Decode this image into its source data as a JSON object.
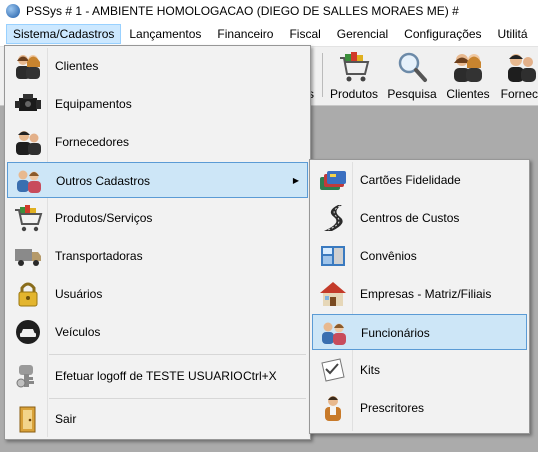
{
  "window": {
    "title": "PSSys # 1 - AMBIENTE HOMOLOGACAO (DIEGO DE SALLES MORAES ME) #"
  },
  "menubar": {
    "items": [
      "Sistema/Cadastros",
      "Lançamentos",
      "Financeiro",
      "Fiscal",
      "Gerencial",
      "Configurações",
      "Utilitá"
    ]
  },
  "toolbar": {
    "partial_label": "s",
    "buttons": [
      {
        "label": "Produtos",
        "icon": "shopping-cart-icon"
      },
      {
        "label": "Pesquisa",
        "icon": "magnifier-icon"
      },
      {
        "label": "Clientes",
        "icon": "people-icon"
      },
      {
        "label": "Fornec.",
        "icon": "supplier-icon"
      }
    ]
  },
  "main_menu": {
    "items": [
      {
        "label": "Clientes",
        "icon": "people-icon"
      },
      {
        "label": "Equipamentos",
        "icon": "engine-icon"
      },
      {
        "label": "Fornecedores",
        "icon": "supplier-people-icon"
      },
      {
        "label": "Outros Cadastros",
        "icon": "group-icon",
        "submenu": true,
        "highlighted": true
      },
      {
        "label": "Produtos/Serviços",
        "icon": "shopping-cart-icon"
      },
      {
        "label": "Transportadoras",
        "icon": "truck-icon"
      },
      {
        "label": "Usuários",
        "icon": "padlock-icon"
      },
      {
        "label": "Veículos",
        "icon": "car-icon"
      },
      {
        "label": "Efetuar logoff de TESTE USUARIO",
        "shortcut": "Ctrl+X",
        "icon": "logoff-key-icon"
      },
      {
        "label": "Sair",
        "icon": "exit-door-icon"
      }
    ]
  },
  "submenu": {
    "items": [
      {
        "label": "Cartões Fidelidade",
        "icon": "cards-icon"
      },
      {
        "label": "Centros de Custos",
        "icon": "road-icon"
      },
      {
        "label": "Convênios",
        "icon": "calculator-icon"
      },
      {
        "label": "Empresas - Matriz/Filiais",
        "icon": "house-icon"
      },
      {
        "label": "Funcionários",
        "icon": "employees-icon",
        "highlighted": true
      },
      {
        "label": "Kits",
        "icon": "checklist-icon"
      },
      {
        "label": "Prescritores",
        "icon": "doctor-icon"
      }
    ]
  },
  "colors": {
    "highlight_bg": "#cde6f7",
    "highlight_border": "#5b9bd5",
    "workspace": "#ababab"
  }
}
